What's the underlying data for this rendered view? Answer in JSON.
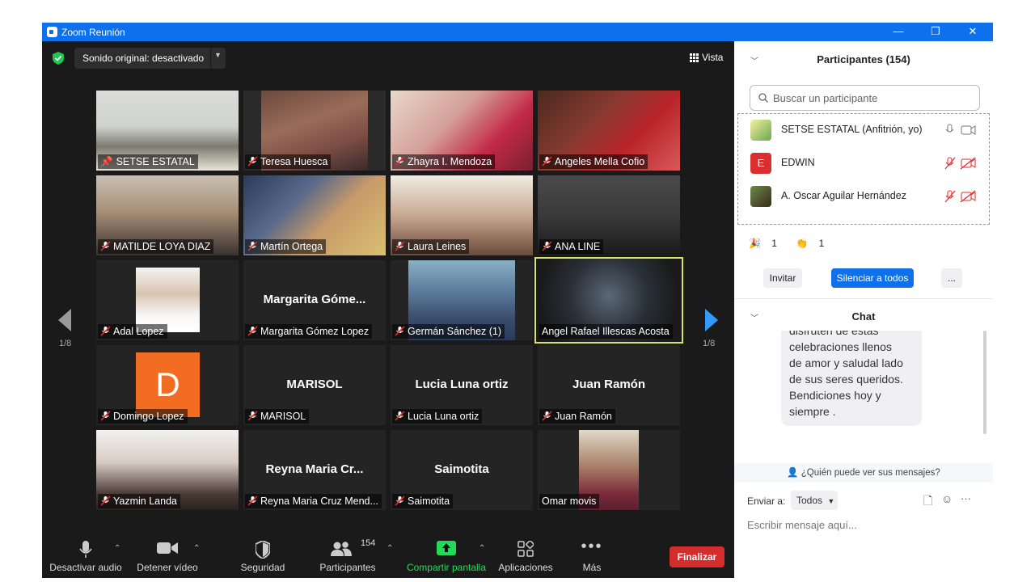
{
  "window": {
    "title": "Zoom Reunión",
    "controls": {
      "minimize": "—",
      "restore": "❐",
      "close": "✕"
    }
  },
  "topbar": {
    "audio_label": "Sonido original: desactivado",
    "view_label": "Vista"
  },
  "pagination": {
    "left": "1/8",
    "right": "1/8"
  },
  "tiles": [
    {
      "name": "SETSE ESTATAL",
      "pinned": true
    },
    {
      "name": "Teresa Huesca"
    },
    {
      "name": "Zhayra I. Mendoza"
    },
    {
      "name": "Angeles Mella Cofio"
    },
    {
      "name": "MATILDE LOYA DIAZ"
    },
    {
      "name": "Martín Ortega"
    },
    {
      "name": "Laura Leines"
    },
    {
      "name": "ANA LINE"
    },
    {
      "name": "Adal Lopez"
    },
    {
      "name": "Margarita Gómez Lopez",
      "display": "Margarita  Góme..."
    },
    {
      "name": "Germán Sánchez (1)"
    },
    {
      "name": "Angel Rafael Illescas Acosta"
    },
    {
      "name": "Domingo Lopez",
      "avatar_letter": "D"
    },
    {
      "name": "MARISOL",
      "display": "MARISOL"
    },
    {
      "name": "Lucia Luna ortiz",
      "display": "Lucia Luna ortiz"
    },
    {
      "name": "Juan Ramón",
      "display": "Juan Ramón"
    },
    {
      "name": "Yazmin Landa"
    },
    {
      "name": "Reyna Maria Cruz Mend...",
      "display": "Reyna  Maria  Cr..."
    },
    {
      "name": "Saimotita",
      "display": "Saimotita"
    },
    {
      "name": "Omar movis"
    }
  ],
  "toolbar": {
    "audio": "Desactivar audio",
    "video": "Detener vídeo",
    "security": "Seguridad",
    "participants": "Participantes",
    "participants_count": "154",
    "share": "Compartir pantalla",
    "apps": "Aplicaciones",
    "more": "Más",
    "end": "Finalizar"
  },
  "panel": {
    "participants_title": "Participantes (154)",
    "search_placeholder": "Buscar un participante",
    "participants": [
      {
        "name": "SETSE ESTATAL (Anfitrión, yo)"
      },
      {
        "name": "EDWIN",
        "initial": "E"
      },
      {
        "name": "A. Oscar Aguilar Hernández"
      }
    ],
    "reactions": {
      "raise_count": "1",
      "clap_count": "1"
    },
    "invite": "Invitar",
    "mute_all": "Silenciar a todos",
    "more": "...",
    "chat_title": "Chat",
    "chat_message_lines": [
      "disfruten de estas",
      "celebraciones  llenos",
      "de amor y saludal lado",
      "de sus seres queridos.",
      "Bendiciones hoy y",
      "siempre ."
    ],
    "who_can_see": "¿Quién puede ver sus mensajes?",
    "send_to_label": "Enviar a:",
    "send_to_value": "Todos",
    "message_placeholder": "Escribir mensaje aquí..."
  },
  "colors": {
    "zoom_blue": "#0e71eb",
    "end_red": "#d32d2d",
    "share_green": "#23d959",
    "active_border": "#d9e36a"
  }
}
